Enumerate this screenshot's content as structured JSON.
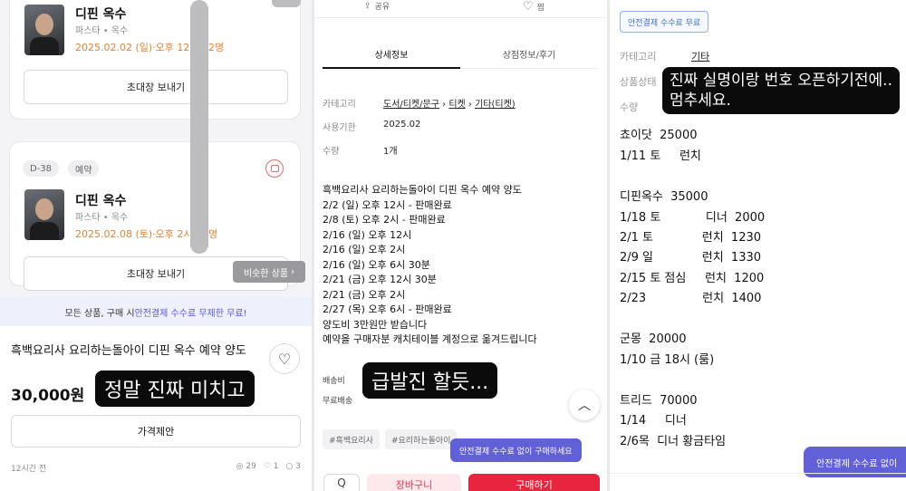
{
  "panel1": {
    "card1": {
      "shop_name": "디핀 옥수",
      "shop_sub": "파스타 • 옥수",
      "date": "2025.02.02 (일)·오후 12시 · 2명",
      "invite_button": "초대장 보내기"
    },
    "card2": {
      "dday": "D-38",
      "status": "예약",
      "shop_name": "디핀 옥수",
      "shop_sub": "파스타 • 옥수",
      "date": "2025.02.08 (토)·오후 2시 · 2명",
      "invite_button": "초대장 보내기"
    },
    "similar_button": "비슷한 상품",
    "banner_prefix": "모든 상품, 구매 시 ",
    "banner_highlight": "안전결제 수수료 무제한 무료!",
    "product_title": "흑백요리사 요리하는돌아이 디핀 옥수 예약 양도",
    "price": "30,000원",
    "offer_button": "가격제안",
    "time_ago": "12시간 전",
    "views": "29",
    "likes": "1",
    "chats": "3",
    "caption": "정말 진짜 미치고"
  },
  "panel2": {
    "share_label": "공유",
    "like_label": "찜",
    "tab_detail": "상세정보",
    "tab_store": "상점정보/후기",
    "category_label": "카테고리",
    "category_path": [
      "도서/티켓/문구",
      "티켓",
      "기타(티켓)"
    ],
    "expiry_label": "사용기한",
    "expiry_value": "2025.02",
    "qty_label": "수량",
    "qty_value": "1개",
    "description": [
      "흑백요리사 요리하는돌아이 디핀 옥수 예약 양도",
      "2/2 (일) 오후 12시 - 판매완료",
      "2/8 (토) 오후 2시 - 판매완료",
      "2/16 (일) 오후 12시",
      "2/16 (일) 오후 2시",
      "2/16 (일) 오후 6시 30분",
      "2/21 (금) 오후 12시 30분",
      "2/21 (금) 오후 2시",
      "2/27 (목) 오후 6시 - 판매완료",
      "양도비 3만원만 받습니다",
      "예약을 구매자분 캐치테이블 계정으로 옮겨드립니다"
    ],
    "shipping_label": "배송비",
    "shipping_value": "무료배송",
    "tags": [
      "#흑백요리사",
      "#요리하는돌아이"
    ],
    "tooltip": "안전결제 수수료 없이 구매하세요",
    "search_button": "Q",
    "cart_button": "장바구니",
    "buy_button": "구매하기",
    "caption": "급발진 할듯..."
  },
  "panel3": {
    "badge": "안전결제 수수료 무료",
    "category_label": "카테고리",
    "category_value": "기타",
    "status_label": "상품상태",
    "qty_label": "수량",
    "caption": "진짜 실명이랑 번호 오픈하기전에..\n멈추세요.",
    "lines": [
      "쵸이닷  25000",
      "1/11 토     런치",
      "",
      "디핀옥수  35000",
      "1/18 토            디너  2000",
      "2/1 토             런치  1230",
      "2/9 일             런치  1330",
      "2/15 토 점심     런치  1200",
      "2/23               런치  1400",
      "",
      "군몽  20000",
      "1/10 금 18시 (룸)",
      "",
      "트리드  70000",
      "1/14     디너",
      "2/6목  디너 황금타임"
    ],
    "tooltip": "안전결제 수수료 없이"
  }
}
